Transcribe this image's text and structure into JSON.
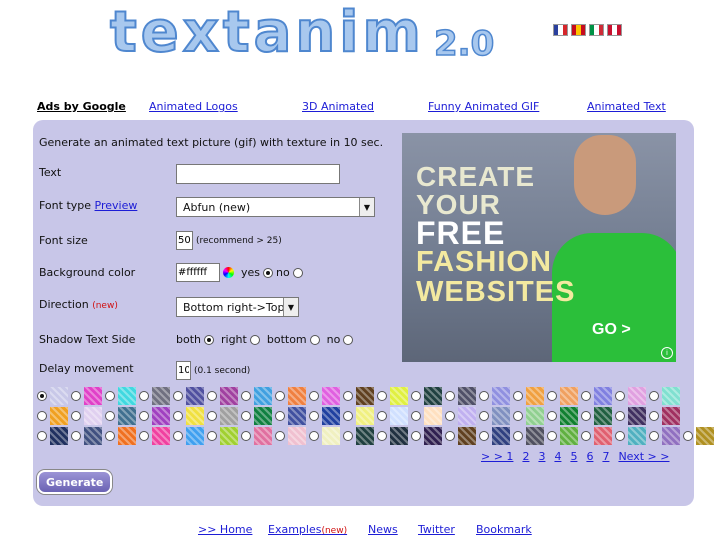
{
  "logo": {
    "text": "textanim",
    "version": "2.0"
  },
  "flags": [
    {
      "name": "france-flag",
      "colors": [
        "#2a3f9d",
        "#ffffff",
        "#d6262b"
      ]
    },
    {
      "name": "spain-flag",
      "colors": [
        "#c60b1e",
        "#ffc400",
        "#c60b1e"
      ]
    },
    {
      "name": "italy-flag",
      "colors": [
        "#009246",
        "#ffffff",
        "#ce2b37"
      ]
    },
    {
      "name": "uk-flag",
      "colors": [
        "#c8102e",
        "#ffffff",
        "#c8102e"
      ]
    }
  ],
  "adlinks": {
    "ads_by": "Ads by Google",
    "l1": "Animated Logos",
    "l2": "3D Animated",
    "l3": "Funny Animated GIF",
    "l4": "Animated Text"
  },
  "form": {
    "intro": "Generate an animated text picture (gif) with texture in 10 sec.",
    "text_label": "Text",
    "text_value": "",
    "font_type_label": "Font type",
    "font_preview": "Preview",
    "font_value": "Abfun (new)",
    "font_size_label": "Font size",
    "font_size_value": "50",
    "font_size_hint": "(recommend > 25)",
    "bg_label": "Background color",
    "bg_value": "#ffffff",
    "bg_yes": "yes",
    "bg_no": "no",
    "direction_label": "Direction",
    "direction_new": "(new)",
    "direction_value": "Bottom right->Top",
    "shadow_label": "Shadow Text Side",
    "shadow_both": "both",
    "shadow_right": "right",
    "shadow_bottom": "bottom",
    "shadow_no": "no",
    "delay_label": "Delay movement",
    "delay_value": "10",
    "delay_hint": "(0.1 second)"
  },
  "ad": {
    "line1": "CREATE",
    "line2": "YOUR",
    "line3": "FREE",
    "line4": "FASHION",
    "line5": "WEBSITES",
    "go": "GO >",
    "info": "i"
  },
  "textures": {
    "row1": [
      "#c8c8e8",
      "#e040c8",
      "#40d8e0",
      "#707080",
      "#5050a0",
      "#a040a0",
      "#40a0e0",
      "#f08040",
      "#e060e0",
      "#604020",
      "#e0f040",
      "#204040",
      "#505068",
      "#9090e0",
      "#f0a040",
      "#f0a060",
      "#8080e0",
      "#e0a0e0",
      "#80e0d0"
    ],
    "row2": [
      "#f0a020",
      "#e0d0f0",
      "#407090",
      "#a040c0",
      "#f0e040",
      "#a0a0a0",
      "#108040",
      "#4050a0",
      "#2040a0",
      "#f0f080",
      "#d0e0ff",
      "#ffe0c0",
      "#c0b0f0",
      "#8090c0",
      "#90d090",
      "#108030",
      "#206040",
      "#403060",
      "#a03060"
    ],
    "row3": [
      "#203060",
      "#405080",
      "#f07020",
      "#f040a0",
      "#40a0f0",
      "#a0d030",
      "#e070a0",
      "#f0c0d0",
      "#f0f0c0",
      "#204040",
      "#203040",
      "#302050",
      "#604020",
      "#304080",
      "#505060",
      "#60b040",
      "#e06070",
      "#50b0c0",
      "#9070c0",
      "#b09020"
    ]
  },
  "pagination": [
    "> > 1",
    "2",
    "3",
    "4",
    "5",
    "6",
    "7",
    "Next > >"
  ],
  "generate_label": "Generate",
  "footer": {
    "home": ">> Home",
    "examples": "Examples",
    "examples_new": "(new)",
    "news": "News",
    "twitter": "Twitter",
    "bookmark": "Bookmark"
  }
}
